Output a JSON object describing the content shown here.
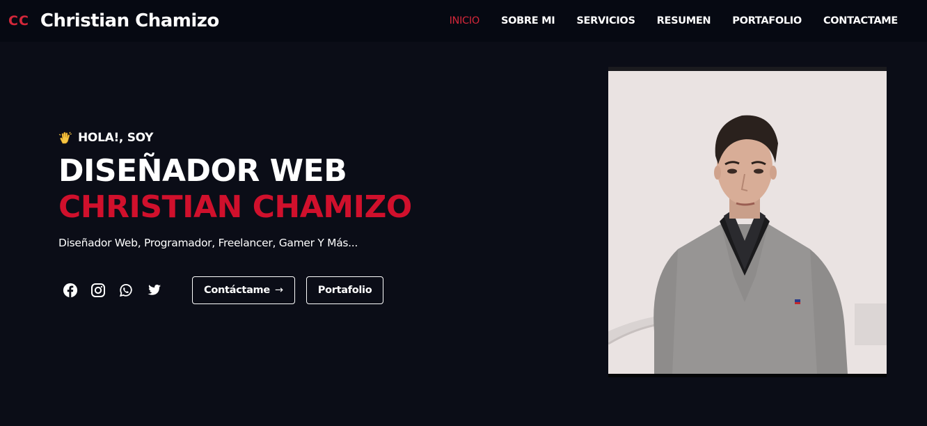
{
  "brand": {
    "mark": "CC",
    "name": "Christian Chamizo"
  },
  "nav": {
    "items": [
      {
        "label": "INICIO",
        "active": true
      },
      {
        "label": "SOBRE MI",
        "active": false
      },
      {
        "label": "SERVICIOS",
        "active": false
      },
      {
        "label": "RESUMEN",
        "active": false
      },
      {
        "label": "PORTAFOLIO",
        "active": false
      },
      {
        "label": "CONTACTAME",
        "active": false
      }
    ]
  },
  "hero": {
    "greeting_icon": "waving-hand-icon",
    "greeting": "HOLA!, SOY",
    "role": "DISEÑADOR WEB",
    "name": "CHRISTIAN CHAMIZO",
    "tagline": "Diseñador Web, Programador, Freelancer, Gamer Y Más...",
    "social": [
      "facebook-icon",
      "instagram-icon",
      "whatsapp-icon",
      "twitter-icon"
    ],
    "buttons": {
      "contact": "Contáctame",
      "contact_arrow": "→",
      "portfolio": "Portafolio"
    }
  },
  "colors": {
    "background": "#0b0d17",
    "navbar": "#060912",
    "accent": "#d3273a",
    "name_red": "#d0102c",
    "text": "#ffffff"
  }
}
